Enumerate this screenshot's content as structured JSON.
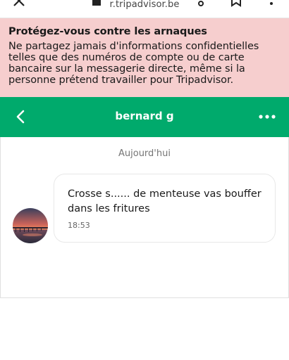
{
  "browser": {
    "url": "r.tripadvisor.be"
  },
  "warning": {
    "title": "Protégez-vous contre les arnaques",
    "body": "Ne partagez jamais d'informations confidentielles telles que des numéros de compte ou de carte bancaire sur la messagerie directe, même si la personne prétend travailler pour Tripadvisor."
  },
  "header": {
    "contact_name": "bernard g",
    "back_icon": "chevron-left-icon",
    "more_icon": "more-horizontal-icon",
    "color": "#00aa6c"
  },
  "chat": {
    "day_label": "Aujourd'hui",
    "messages": [
      {
        "text": "Crosse s...... de menteuse vas bouffer dans les fritures",
        "time": "18:53"
      }
    ]
  }
}
